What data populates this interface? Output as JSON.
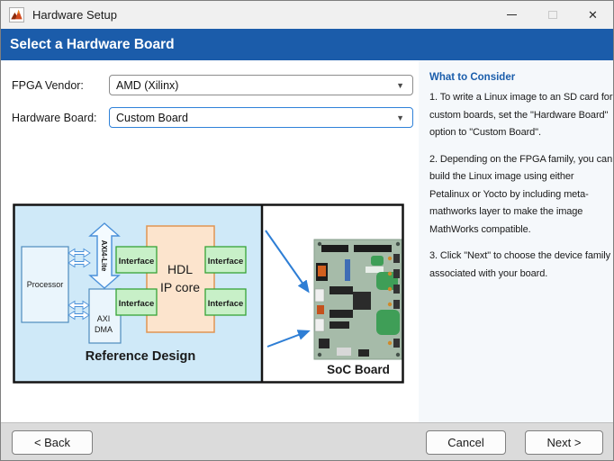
{
  "window": {
    "title": "Hardware Setup"
  },
  "icons": {
    "app": "matlab-logo",
    "close": "✕",
    "dropdown_arrow": "▼"
  },
  "header": {
    "title": "Select a Hardware Board"
  },
  "form": {
    "fpga_vendor": {
      "label": "FPGA Vendor:",
      "value": "AMD (Xilinx)"
    },
    "hardware_board": {
      "label": "Hardware Board:",
      "value": "Custom Board"
    }
  },
  "diagram": {
    "processor_label": "Processor",
    "axi4_lite_label": "AXI4-Lite",
    "axi_dma_line1": "AXI",
    "axi_dma_line2": "DMA",
    "interface_label": "Interface",
    "hdl_ip_core_line1": "HDL",
    "hdl_ip_core_line2": "IP core",
    "reference_design_label": "Reference Design",
    "soc_board_label": "SoC Board"
  },
  "sidebar": {
    "title": "What to Consider",
    "paragraphs": [
      "1. To write a Linux image to an SD card for custom boards, set the \"Hardware Board\" option to \"Custom Board\".",
      "2. Depending on the FPGA family, you can build the Linux image using either Petalinux or Yocto by including meta-mathworks layer to make the image MathWorks compatible.",
      "3. Click \"Next\" to choose the device family associated with your board."
    ]
  },
  "footer": {
    "back_label": "< Back",
    "cancel_label": "Cancel",
    "next_label": "Next >"
  },
  "colors": {
    "header_bg": "#1b5caa",
    "sidebar_title": "#1a5dab",
    "focus_border": "#2f81d8",
    "diagram_panel_bg": "#cfe9f8",
    "interface_fill": "#c8f0c8",
    "interface_border": "#36a336",
    "hdl_fill": "#fce4cd",
    "hdl_border": "#e09553",
    "arrow_blue": "#2e7ed5"
  }
}
